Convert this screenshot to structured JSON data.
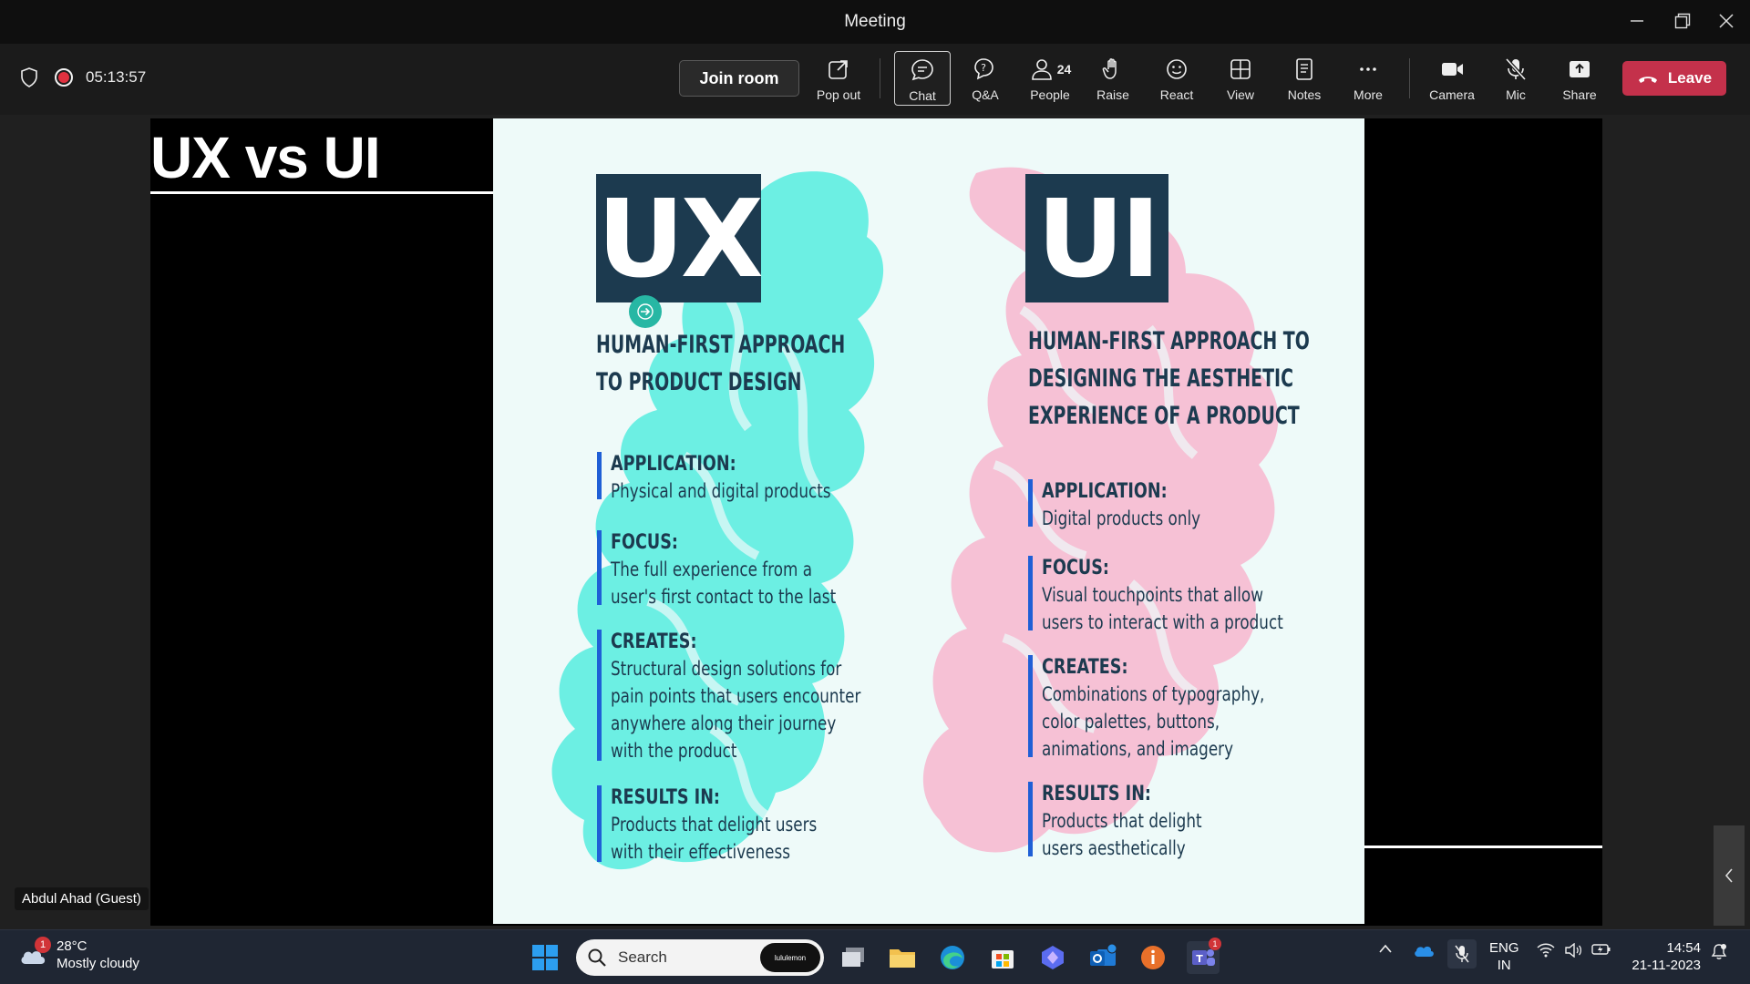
{
  "window": {
    "title": "Meeting"
  },
  "toolbar": {
    "timer": "05:13:57",
    "join_room": "Join room",
    "buttons": {
      "popout": "Pop out",
      "chat": "Chat",
      "qa": "Q&A",
      "people": "People",
      "people_count": "24",
      "raise": "Raise",
      "react": "React",
      "view": "View",
      "notes": "Notes",
      "more": "More",
      "camera": "Camera",
      "mic": "Mic",
      "share": "Share"
    },
    "leave": "Leave"
  },
  "slide": {
    "title": "UX vs UI",
    "ux": {
      "badge": "UX",
      "heading": "HUMAN-FIRST APPROACH\nTO PRODUCT DESIGN",
      "items": [
        {
          "key": "APPLICATION:",
          "value": "Physical and digital products"
        },
        {
          "key": "FOCUS:",
          "value": "The full experience from a\nuser's first contact to the last"
        },
        {
          "key": "CREATES:",
          "value": "Structural design solutions for\npain points that users encounter\nanywhere along their journey\nwith the product"
        },
        {
          "key": "RESULTS IN:",
          "value": "Products that delight users\nwith their effectiveness"
        }
      ]
    },
    "ui": {
      "badge": "UI",
      "heading": "HUMAN-FIRST APPROACH TO\nDESIGNING THE AESTHETIC\nEXPERIENCE OF A PRODUCT",
      "items": [
        {
          "key": "APPLICATION:",
          "value": "Digital products only"
        },
        {
          "key": "FOCUS:",
          "value": "Visual touchpoints that allow\nusers to interact with a product"
        },
        {
          "key": "CREATES:",
          "value": "Combinations of typography,\ncolor palettes, buttons,\nanimations, and imagery"
        },
        {
          "key": "RESULTS IN:",
          "value": "Products that delight\nusers aesthetically"
        }
      ]
    },
    "colors": {
      "ux_brain": "#4ee8e0",
      "ui_brain": "#f7b6cf",
      "badge": "#1c3a4f",
      "accent_bar": "#1f5fd6"
    }
  },
  "participant": {
    "name": "Abdul Ahad (Guest)"
  },
  "taskbar": {
    "weather": {
      "temp": "28°C",
      "condition": "Mostly cloudy",
      "badge": "1"
    },
    "search_placeholder": "Search",
    "search_pill": "lululemon",
    "teams_badge": "1",
    "lang_line1": "ENG",
    "lang_line2": "IN",
    "time": "14:54",
    "date": "21-11-2023"
  }
}
